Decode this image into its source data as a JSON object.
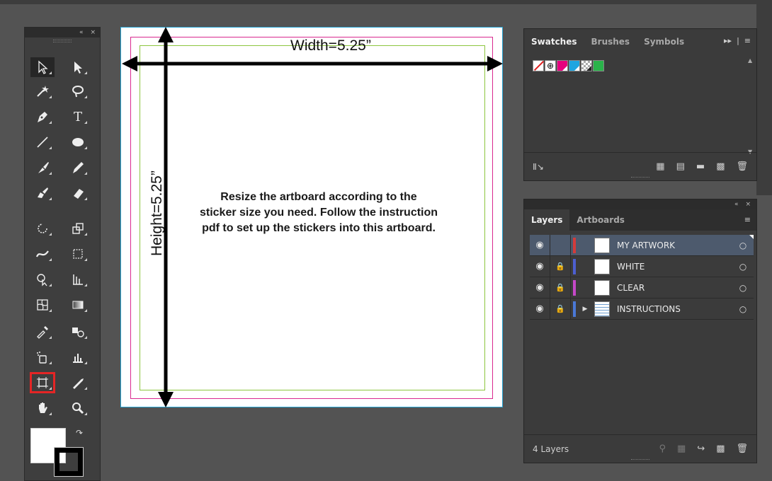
{
  "artboard": {
    "width_label": "Width=5.25”",
    "height_label": "Height=5.25”",
    "instructions": [
      "Resize the artboard according to the",
      "sticker size you need. Follow the instruction",
      "pdf to set up the stickers into this artboard."
    ],
    "colors": {
      "bleed": "#d9288f",
      "safe": "#8cc63f",
      "edge": "#2aa7d6"
    }
  },
  "tools_panel": {
    "header_collapse": "«",
    "header_close": "×"
  },
  "swatches_panel": {
    "tabs": [
      "Swatches",
      "Brushes",
      "Symbols"
    ],
    "active_tab": "Swatches",
    "overflow": "▸▸",
    "menu": "≡",
    "swatches": [
      "none",
      "registration",
      "magenta",
      "cyan",
      "pattern",
      "green"
    ],
    "footer_left": "Ⅱ↘",
    "footer_icons": [
      "▦",
      "▤",
      "▬",
      "▩",
      "✖"
    ]
  },
  "layers_panel": {
    "header_collapse": "«",
    "header_close": "×",
    "tabs": [
      "Layers",
      "Artboards"
    ],
    "active_tab": "Layers",
    "menu": "≡",
    "layers": [
      {
        "name": "MY ARTWORK",
        "color": "#d43b3b",
        "locked": false,
        "expandable": false,
        "selected": true
      },
      {
        "name": "WHITE",
        "color": "#4c5fd0",
        "locked": true,
        "expandable": false,
        "selected": false
      },
      {
        "name": "CLEAR",
        "color": "#c548c8",
        "locked": true,
        "expandable": false,
        "selected": false
      },
      {
        "name": "INSTRUCTIONS",
        "color": "#4a78d6",
        "locked": true,
        "expandable": true,
        "selected": false
      }
    ],
    "footer_count": "4 Layers"
  }
}
